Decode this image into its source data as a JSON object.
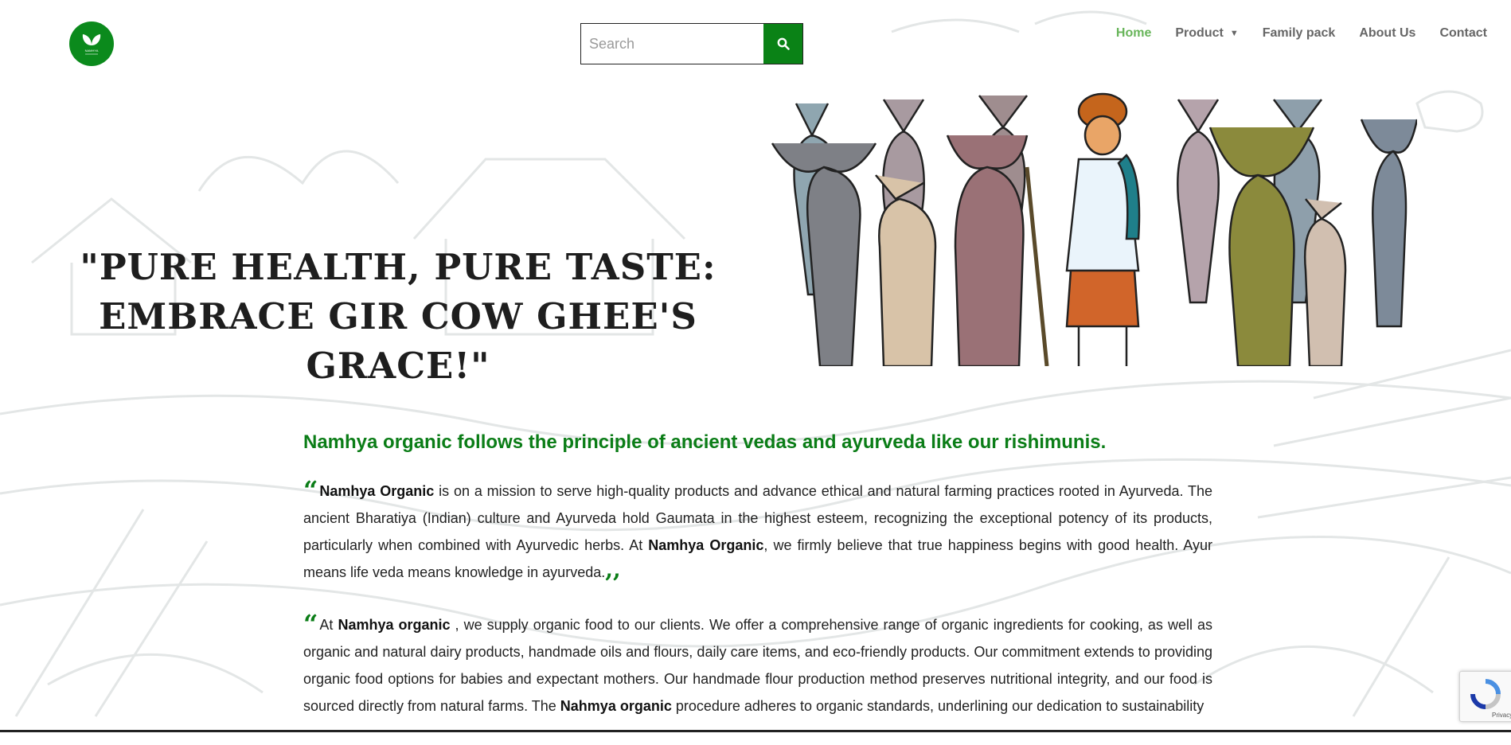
{
  "header": {
    "logo_text": "NAMHYA",
    "search": {
      "placeholder": "Search"
    },
    "nav": [
      {
        "label": "Home",
        "active": true
      },
      {
        "label": "Product",
        "active": false,
        "has_dropdown": true
      },
      {
        "label": "Family pack",
        "active": false
      },
      {
        "label": "About Us",
        "active": false
      },
      {
        "label": "Contact",
        "active": false
      }
    ]
  },
  "banner": {
    "quote_line1": "\"PURE HEALTH, PURE TASTE:",
    "quote_line2": "EMBRACE GIR COW GHEE'S GRACE!\""
  },
  "content": {
    "heading": "Namhya organic follows the principle of ancient vedas and ayurveda like our rishimunis.",
    "para1": {
      "open_quote": "“",
      "brand1": "Namhya Organic",
      "text1": " is on a mission to serve high-quality products and advance ethical and natural farming practices rooted in Ayurveda. The ancient Bharatiya (Indian) culture and Ayurveda hold Gaumata in the highest esteem, recognizing the exceptional potency of its products, particularly when combined with Ayurvedic herbs. At ",
      "brand2": "Namhya Organic",
      "text2": ", we firmly believe that true happiness begins with good health. Ayur means life veda means knowledge in ayurveda.",
      "close_quote": ",,"
    },
    "para2": {
      "open_quote": "“",
      "text0": "At ",
      "brand1": "Namhya organic",
      "text1": " , we supply organic food to our clients. We offer a comprehensive range of organic ingredients for cooking, as well as organic and natural dairy products, handmade oils and flours, daily care items, and eco-friendly products. Our commitment extends to providing organic food options for babies and expectant mothers. Our handmade flour production method preserves nutritional integrity, and our food is sourced directly from natural farms. The ",
      "brand2": "Nahmya organic",
      "text2": " procedure adheres to organic standards, underlining our dedication to sustainability"
    }
  },
  "recaptcha": {
    "text": "Privacy - Terms"
  },
  "colors": {
    "brand_green": "#0b7d17",
    "nav_active": "#68b55a",
    "nav_text": "#666666"
  }
}
